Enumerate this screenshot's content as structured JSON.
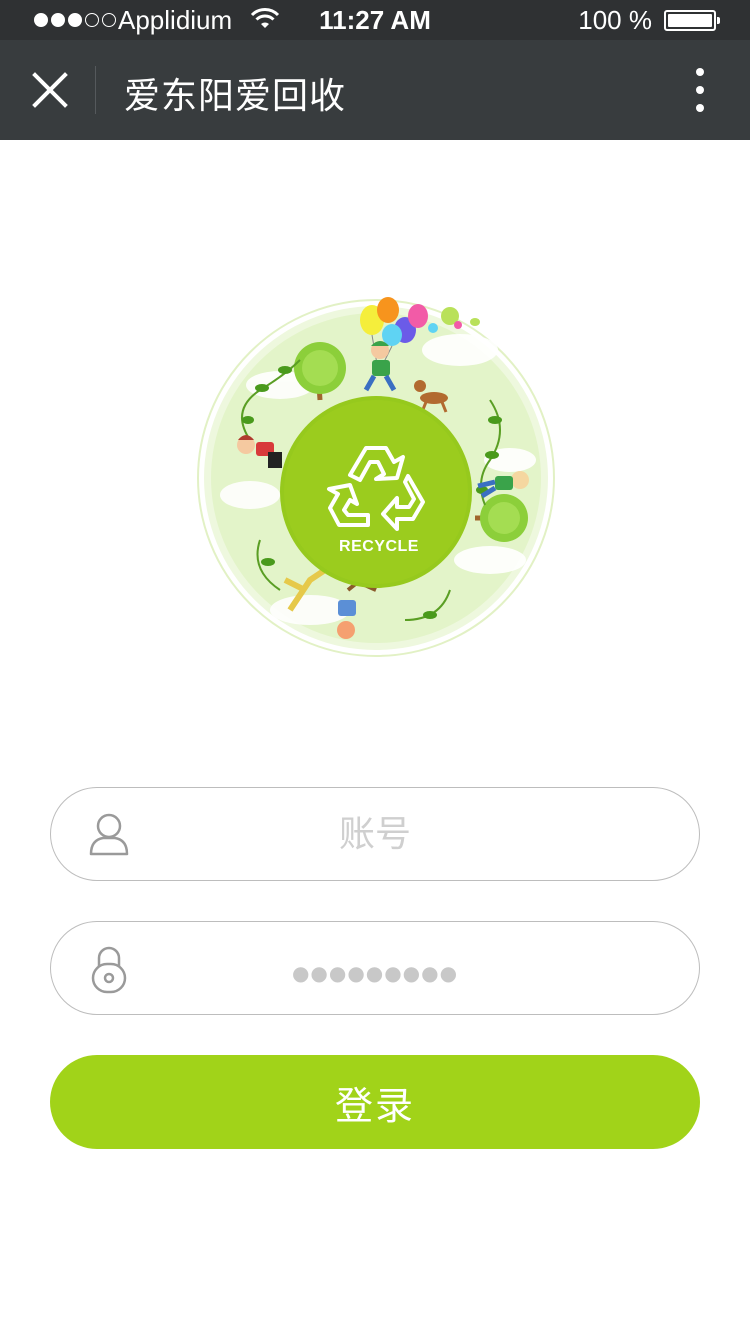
{
  "status_bar": {
    "carrier": "Applidium",
    "time": "11:27 AM",
    "battery": "100 %"
  },
  "nav": {
    "title": "爱东阳爱回收",
    "close_icon": "close-icon",
    "more_icon": "more-vertical-icon"
  },
  "logo": {
    "label": "RECYCLE"
  },
  "form": {
    "account_placeholder": "账号",
    "password_placeholder": "●●●●●●●●●",
    "account_icon": "user-icon",
    "password_icon": "lock-icon"
  },
  "login_button": "登录",
  "colors": {
    "brand_green": "#a1d319",
    "nav_bg": "#383c3e",
    "status_bg": "#2f3133"
  }
}
